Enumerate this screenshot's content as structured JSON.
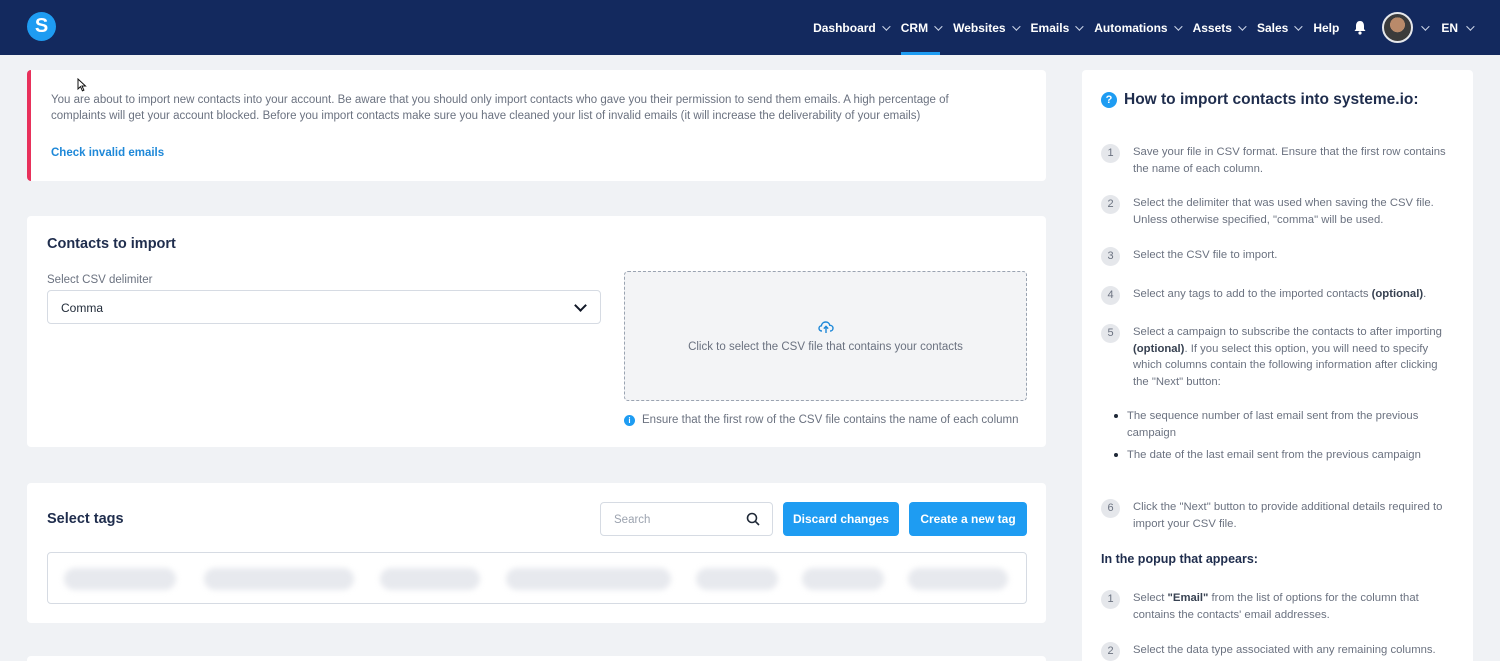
{
  "header": {
    "logo_letter": "S",
    "nav": [
      {
        "label": "Dashboard",
        "chevron": true,
        "active": false
      },
      {
        "label": "CRM",
        "chevron": true,
        "active": true
      },
      {
        "label": "Websites",
        "chevron": true,
        "active": false
      },
      {
        "label": "Emails",
        "chevron": true,
        "active": false
      },
      {
        "label": "Automations",
        "chevron": true,
        "active": false
      },
      {
        "label": "Assets",
        "chevron": true,
        "active": false
      },
      {
        "label": "Sales",
        "chevron": true,
        "active": false
      },
      {
        "label": "Help",
        "chevron": false,
        "active": false
      }
    ],
    "language": "EN",
    "accent_color": "#1e9cf2",
    "bar_color": "#13295e"
  },
  "warning": {
    "text": "You are about to import new contacts into your account. Be aware that you should only import contacts who gave you their permission to send them emails. A high percentage of complaints will get your account blocked. Before you import contacts make sure you have cleaned your list of invalid emails (it will increase the deliverability of your emails)",
    "link": "Check invalid emails",
    "border_color": "#e8315b"
  },
  "contacts": {
    "title": "Contacts to import",
    "delimiter_label": "Select CSV delimiter",
    "delimiter_value": "Comma",
    "dropzone_text": "Click to select the CSV file that contains your contacts",
    "hint": "Ensure that the first row of the CSV file contains the name of each column"
  },
  "tags": {
    "title": "Select tags",
    "search_placeholder": "Search",
    "discard_label": "Discard changes",
    "create_label": "Create a new tag"
  },
  "guide": {
    "title": "How to import contacts into systeme.io:",
    "steps": [
      {
        "num": "1",
        "text": "Save your file in CSV format. Ensure that the first row contains the name of each column."
      },
      {
        "num": "2",
        "text": "Select the delimiter that was used when saving the CSV file. Unless otherwise specified, \"comma\" will be used."
      },
      {
        "num": "3",
        "text": "Select the CSV file to import."
      },
      {
        "num": "4",
        "text_before": "Select any tags to add to the imported contacts ",
        "bold": "(optional)",
        "text_after": "."
      },
      {
        "num": "5",
        "text_before": "Select a campaign to subscribe the contacts to after importing ",
        "bold": "(optional)",
        "text_after": ". If you select this option, you will need to specify which columns contain the following information after clicking the \"Next\" button:"
      },
      {
        "num": "6",
        "text": "Click the \"Next\" button to provide additional details required to import your CSV file."
      }
    ],
    "bullets": [
      "The sequence number of last email sent from the previous campaign",
      "The date of the last email sent from the previous campaign"
    ],
    "popup_title": "In the popup that appears:",
    "popup_steps": [
      {
        "num": "1",
        "bold": "\"Email\"",
        "text_before": "Select ",
        "text_after": " from the list of options for the column that contains the contacts' email addresses."
      },
      {
        "num": "2",
        "text": "Select the data type associated with any remaining columns."
      }
    ]
  }
}
